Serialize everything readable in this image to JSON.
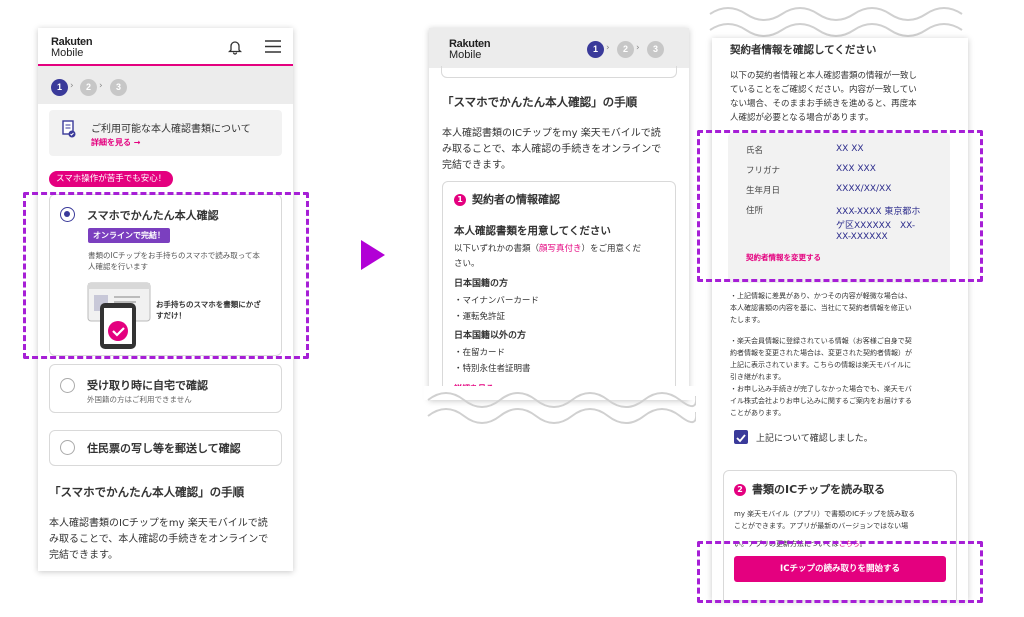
{
  "brand": {
    "logo_line1": "Rakuten",
    "logo_line2": "Mobile"
  },
  "colors": {
    "accent": "#e4007f",
    "navy": "#3a3a9a",
    "highlight": "#a61fd6"
  },
  "steps": {
    "one": "1",
    "two": "2",
    "three": "3"
  },
  "left": {
    "doc_info_text": "ご利用可能な本人確認書類について",
    "doc_info_link": "詳細を見る →",
    "pill": "スマホ操作が苦手でも安心！",
    "option1": {
      "title": "スマホでかんたん本人確認",
      "badge": "オンラインで完結！",
      "desc1": "書類のICチップをお手持ちのスマホで読み取って本",
      "desc2": "人確認を行います",
      "illus1": "お手持ちのスマホを書類にかざ",
      "illus2": "すだけ！"
    },
    "option2": {
      "title": "受け取り時に自宅で確認",
      "sub": "外国籍の方はご利用できません"
    },
    "option3": {
      "title": "住民票の写し等を郵送して確認"
    },
    "heading": "「スマホでかんたん本人確認」の手順",
    "para1": "本人確認書類のICチップをmy 楽天モバイルで読",
    "para2": "み取ることで、本人確認の手続きをオンラインで",
    "para3": "完結できます。"
  },
  "middle": {
    "heading": "「スマホでかんたん本人確認」の手順",
    "para1": "本人確認書類のICチップをmy 楽天モバイルで読",
    "para2": "み取ることで、本人確認の手続きをオンラインで",
    "para3": "完結できます。",
    "section_num": "1",
    "section_title": "契約者の情報確認",
    "subheading": "本人確認書類を用意してください",
    "req1": "以下いずれかの書類（",
    "req_highlight": "顔写真付き",
    "req2": "）をご用意くだ",
    "req3": "さい。",
    "jp_title": "日本国籍の方",
    "jp_items": [
      "・マイナンバーカード",
      "・運転免許証"
    ],
    "nonjp_title": "日本国籍以外の方",
    "nonjp_items": [
      "・在留カード",
      "・特別永住者証明書"
    ],
    "link": "詳細を見る →"
  },
  "right": {
    "top_heading": "契約者情報を確認してください",
    "intro": [
      "以下の契約者情報と本人確認書類の情報が一致し",
      "ていることをご確認ください。内容が一致してい",
      "ない場合、そのままお手続きを進めると、再度本",
      "人確認が必要となる場合があります。"
    ],
    "fields": [
      {
        "label": "氏名",
        "value": "XX XX"
      },
      {
        "label": "フリガナ",
        "value": "XXX XXX"
      },
      {
        "label": "生年月日",
        "value": "XXXX/XX/XX"
      },
      {
        "label": "住所",
        "value": "XXX-XXXX 東京都ホ",
        "value2": "ゲ区XXXXXX　XX-",
        "value3": "XX-XXXXXX"
      }
    ],
    "change_link": "契約者情報を変更する",
    "note1": [
      "・上記情報に差異があり、かつその内容が軽微な場合は、",
      "本人確認書類の内容を基に、当社にて契約者情報を修正い",
      "たします。"
    ],
    "note2": [
      "・楽天会員情報に登録されている情報（お客様ご自身で契",
      "約者情報を変更された場合は、変更された契約者情報）が",
      "上記に表示されています。こちらの情報は楽天モバイルに",
      "引き継がれます。",
      "・お申し込み手続きが完了しなかった場合でも、楽天モバ",
      "イル株式会社よりお申し込みに関するご案内をお届けする",
      "ことがあります。"
    ],
    "checkbox_label": "上記について確認しました。",
    "section2_num": "2",
    "section2_title": "書類のICチップを読み取る",
    "s2_desc": [
      "my 楽天モバイル（アプリ）で書類のICチップを読み取る",
      "ことができます。アプリが最新のバージョンではない場"
    ],
    "s2_tail": "い。アプリの更新方法については",
    "s2_link": "こちら",
    "s2_tail_end": "。",
    "button": "ICチップの読み取りを開始する"
  }
}
